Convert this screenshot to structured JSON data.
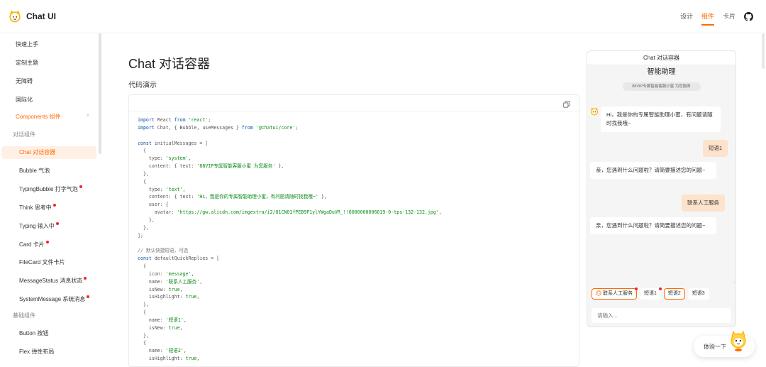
{
  "header": {
    "brand": "Chat UI",
    "nav": [
      "设计",
      "组件",
      "卡片"
    ],
    "active_nav": "组件"
  },
  "sidebar": {
    "items": [
      {
        "label": "快速上手",
        "kind": "item"
      },
      {
        "label": "定制主题",
        "kind": "item"
      },
      {
        "label": "无障碍",
        "kind": "item"
      },
      {
        "label": "国际化",
        "kind": "item"
      },
      {
        "label": "Components 组件",
        "kind": "section"
      },
      {
        "label": "对话组件",
        "kind": "group"
      },
      {
        "label": "Chat 对话容器",
        "kind": "active"
      },
      {
        "label": "Bubble 气泡",
        "kind": "sub"
      },
      {
        "label": "TypingBubble 打字气泡",
        "kind": "sub",
        "dot": true
      },
      {
        "label": "Think 思考中",
        "kind": "sub",
        "dot": true
      },
      {
        "label": "Typing 输入中",
        "kind": "sub",
        "dot": true
      },
      {
        "label": "Card 卡片",
        "kind": "sub",
        "dot": true
      },
      {
        "label": "FileCard 文件卡片",
        "kind": "sub"
      },
      {
        "label": "MessageStatus 消息状态",
        "kind": "sub",
        "dot": true
      },
      {
        "label": "SystemMessage 系统消息",
        "kind": "sub",
        "dot": true
      },
      {
        "label": "基础组件",
        "kind": "group"
      },
      {
        "label": "Button 按钮",
        "kind": "sub"
      },
      {
        "label": "Flex 弹性布局",
        "kind": "sub"
      }
    ],
    "section_chevron": "^"
  },
  "main": {
    "title": "Chat 对话容器",
    "demo_label": "代码演示"
  },
  "code_lines": [
    [
      [
        "kw",
        "import"
      ],
      [
        "pun",
        " React "
      ],
      [
        "kw",
        "from"
      ],
      [
        "str",
        " 'react'"
      ],
      [
        "pun",
        ";"
      ]
    ],
    [
      [
        "kw",
        "import"
      ],
      [
        "pun",
        " Chat, { Bubble, useMessages } "
      ],
      [
        "kw",
        "from"
      ],
      [
        "str",
        " '@chatui/core'"
      ],
      [
        "pun",
        ";"
      ]
    ],
    [
      [
        "pun",
        ""
      ]
    ],
    [
      [
        "kw",
        "const"
      ],
      [
        "pun",
        " initialMessages = ["
      ]
    ],
    [
      [
        "pun",
        "  {"
      ]
    ],
    [
      [
        "pun",
        "    type: "
      ],
      [
        "str",
        "'system'"
      ],
      [
        "pun",
        ","
      ]
    ],
    [
      [
        "pun",
        "    content: { text: "
      ],
      [
        "str",
        "'88VIP专属智能客服小蜜 为您服务'"
      ],
      [
        "pun",
        " },"
      ]
    ],
    [
      [
        "pun",
        "  },"
      ]
    ],
    [
      [
        "pun",
        "  {"
      ]
    ],
    [
      [
        "pun",
        "    type: "
      ],
      [
        "str",
        "'text'"
      ],
      [
        "pun",
        ","
      ]
    ],
    [
      [
        "pun",
        "    content: { text: "
      ],
      [
        "str",
        "'Hi，我是你的专属智能助理小蜜，有问题请随时找我哦~'"
      ],
      [
        "pun",
        " },"
      ]
    ],
    [
      [
        "pun",
        "    user: {"
      ]
    ],
    [
      [
        "pun",
        "      avatar: "
      ],
      [
        "str",
        "'https://gw.alicdn.com/imgextra/i2/O1CN01fPEB9P1ylYWgaDuVR_!!6000000006619-0-tps-132-132.jpg'"
      ],
      [
        "pun",
        ","
      ]
    ],
    [
      [
        "pun",
        "    },"
      ]
    ],
    [
      [
        "pun",
        "  },"
      ]
    ],
    [
      [
        "pun",
        "];"
      ]
    ],
    [
      [
        "pun",
        ""
      ]
    ],
    [
      [
        "com",
        "// 默认快捷短语，可选"
      ]
    ],
    [
      [
        "kw",
        "const"
      ],
      [
        "pun",
        " defaultQuickReplies = ["
      ]
    ],
    [
      [
        "pun",
        "  {"
      ]
    ],
    [
      [
        "pun",
        "    icon: "
      ],
      [
        "str",
        "'message'"
      ],
      [
        "pun",
        ","
      ]
    ],
    [
      [
        "pun",
        "    name: "
      ],
      [
        "str",
        "'联系人工服务'"
      ],
      [
        "pun",
        ","
      ]
    ],
    [
      [
        "pun",
        "    isNew: "
      ],
      [
        "str",
        "true"
      ],
      [
        "pun",
        ","
      ]
    ],
    [
      [
        "pun",
        "    isHighlight: "
      ],
      [
        "str",
        "true"
      ],
      [
        "pun",
        ","
      ]
    ],
    [
      [
        "pun",
        "  },"
      ]
    ],
    [
      [
        "pun",
        "  {"
      ]
    ],
    [
      [
        "pun",
        "    name: "
      ],
      [
        "str",
        "'短语1'"
      ],
      [
        "pun",
        ","
      ]
    ],
    [
      [
        "pun",
        "    isNew: "
      ],
      [
        "str",
        "true"
      ],
      [
        "pun",
        ","
      ]
    ],
    [
      [
        "pun",
        "  },"
      ]
    ],
    [
      [
        "pun",
        "  {"
      ]
    ],
    [
      [
        "pun",
        "    name: "
      ],
      [
        "str",
        "'短语2'"
      ],
      [
        "pun",
        ","
      ]
    ],
    [
      [
        "pun",
        "    isHighlight: "
      ],
      [
        "str",
        "true"
      ],
      [
        "pun",
        ","
      ]
    ]
  ],
  "preview": {
    "frame_title": "Chat 对话容器",
    "navbar_title": "智能助理",
    "system_message": "88VIP专属智能客服小蜜 为您服务",
    "messages": [
      {
        "side": "left",
        "text": "Hi，我是你的专属智能助理小蜜，有问题请随时找我哦~"
      },
      {
        "side": "right",
        "text": "短语1"
      },
      {
        "side": "left",
        "text": "亲，您遇到什么问题啦？请简要描述您的问题~"
      },
      {
        "side": "right",
        "text": "联系人工服务"
      },
      {
        "side": "left",
        "text": "亲，您遇到什么问题啦？请简要描述您的问题~"
      }
    ],
    "quick_replies": [
      {
        "label": "联系人工服务",
        "highlight": true,
        "new": true,
        "icon": "message-icon"
      },
      {
        "label": "短语1",
        "highlight": false,
        "new": true
      },
      {
        "label": "短语2",
        "highlight": true,
        "new": false
      },
      {
        "label": "短语3",
        "highlight": false,
        "new": false
      }
    ],
    "input_placeholder": "请输入..."
  },
  "try_button": {
    "label": "体验一下"
  },
  "colors": {
    "accent": "#ff6a00",
    "dot": "#f5222d",
    "user_bubble": "#fde2cc",
    "code_blue": "#0451a5",
    "code_green": "#0a8a17"
  }
}
